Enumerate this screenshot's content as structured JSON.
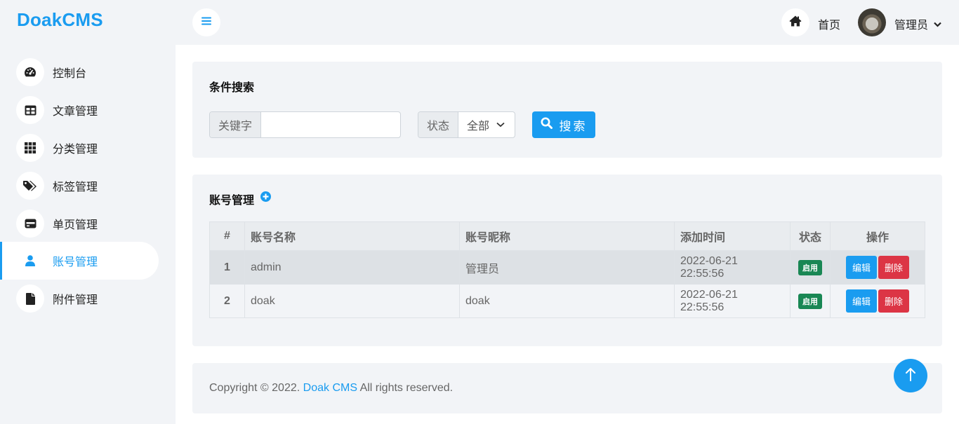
{
  "brand": "DoakCMS",
  "sidebar": {
    "items": [
      {
        "label": "控制台",
        "icon": "gauge-icon"
      },
      {
        "label": "文章管理",
        "icon": "table-icon"
      },
      {
        "label": "分类管理",
        "icon": "grid-icon"
      },
      {
        "label": "标签管理",
        "icon": "tags-icon"
      },
      {
        "label": "单页管理",
        "icon": "card-icon"
      },
      {
        "label": "账号管理",
        "icon": "user-icon",
        "active": true
      },
      {
        "label": "附件管理",
        "icon": "file-icon"
      }
    ]
  },
  "header": {
    "home_label": "首页",
    "user_label": "管理员"
  },
  "search": {
    "title": "条件搜索",
    "keyword_label": "关键字",
    "keyword_value": "",
    "status_label": "状态",
    "status_value": "全部",
    "button_label": "搜索"
  },
  "accounts": {
    "title": "账号管理",
    "columns": [
      "#",
      "账号名称",
      "账号昵称",
      "添加时间",
      "状态",
      "操作"
    ],
    "rows": [
      {
        "id": "1",
        "name": "admin",
        "nickname": "管理员",
        "created": "2022-06-21 22:55:56",
        "status": "启用",
        "edit": "编辑",
        "delete": "删除"
      },
      {
        "id": "2",
        "name": "doak",
        "nickname": "doak",
        "created": "2022-06-21 22:55:56",
        "status": "启用",
        "edit": "编辑",
        "delete": "删除"
      }
    ]
  },
  "footer": {
    "prefix": "Copyright © 2022. ",
    "link": "Doak CMS",
    "suffix": " All rights reserved."
  },
  "colors": {
    "accent": "#1a9cf0",
    "success": "#198754",
    "danger": "#dc3545"
  }
}
